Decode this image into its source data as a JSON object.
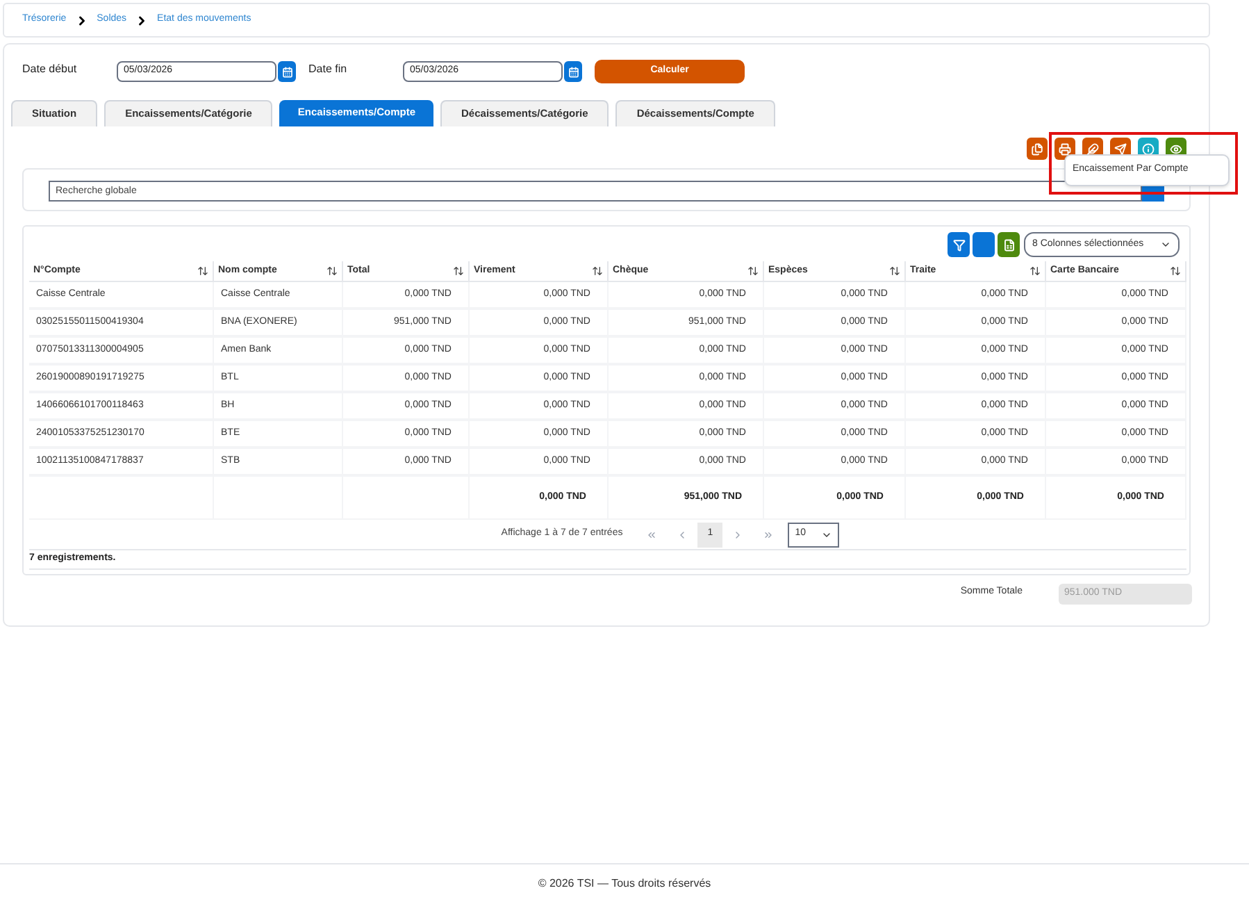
{
  "breadcrumb": [
    {
      "label": "Trésorerie"
    },
    {
      "label": "Soldes"
    },
    {
      "label": "Etat des mouvements"
    }
  ],
  "filters": {
    "date_start": {
      "label": "Date début",
      "value": "05/03/2026"
    },
    "date_end": {
      "label": "Date fin",
      "value": "05/03/2026"
    },
    "submit": "Calculer"
  },
  "tabs": [
    {
      "label": "Situation",
      "selected": false
    },
    {
      "label": "Encaissements/Catégorie",
      "selected": false
    },
    {
      "label": "Encaissements/Compte",
      "selected": true
    },
    {
      "label": "Décaissements/Catégorie",
      "selected": false
    },
    {
      "label": "Décaissements/Compte",
      "selected": false
    }
  ],
  "action_buttons": [
    {
      "kind": "files",
      "color": "#d35400"
    },
    {
      "kind": "print",
      "color": "#d35400"
    },
    {
      "kind": "feather",
      "color": "#d35400"
    },
    {
      "kind": "send",
      "color": "#d35400"
    },
    {
      "kind": "info",
      "color": "#17abc4"
    },
    {
      "kind": "eye",
      "color": "#4e8a0e"
    }
  ],
  "tooltip": "Encaissement Par Compte",
  "search": {
    "placeholder": "Recherche globale"
  },
  "table_toolbar": {
    "buttons": [
      {
        "kind": "filter"
      },
      {
        "kind": "blank"
      },
      {
        "kind": "excel"
      }
    ],
    "columns_select": "8 Colonnes sélectionnées"
  },
  "table": {
    "columns": [
      "N°Compte",
      "Nom compte",
      "Total",
      "Virement",
      "Chèque",
      "Espèces",
      "Traite",
      "Carte Bancaire"
    ],
    "rows": [
      [
        "Caisse Centrale",
        "Caisse Centrale",
        "0,000 TND",
        "0,000 TND",
        "0,000 TND",
        "0,000 TND",
        "0,000 TND",
        "0,000 TND"
      ],
      [
        "03025155011500419304",
        "BNA (EXONERE)",
        "951,000 TND",
        "0,000 TND",
        "951,000 TND",
        "0,000 TND",
        "0,000 TND",
        "0,000 TND"
      ],
      [
        "07075013311300004905",
        "Amen Bank",
        "0,000 TND",
        "0,000 TND",
        "0,000 TND",
        "0,000 TND",
        "0,000 TND",
        "0,000 TND"
      ],
      [
        "26019000890191719275",
        "BTL",
        "0,000 TND",
        "0,000 TND",
        "0,000 TND",
        "0,000 TND",
        "0,000 TND",
        "0,000 TND"
      ],
      [
        "14066066101700118463",
        "BH",
        "0,000 TND",
        "0,000 TND",
        "0,000 TND",
        "0,000 TND",
        "0,000 TND",
        "0,000 TND"
      ],
      [
        "24001053375251230170",
        "BTE",
        "0,000 TND",
        "0,000 TND",
        "0,000 TND",
        "0,000 TND",
        "0,000 TND",
        "0,000 TND"
      ],
      [
        "10021135100847178837",
        "STB",
        "0,000 TND",
        "0,000 TND",
        "0,000 TND",
        "0,000 TND",
        "0,000 TND",
        "0,000 TND"
      ]
    ],
    "totals": [
      "0,000 TND",
      "951,000 TND",
      "0,000 TND",
      "0,000 TND",
      "0,000 TND"
    ]
  },
  "pagination": {
    "info": "Affichage 1 à 7 de 7 entrées",
    "pages": [
      {
        "label": "1",
        "selected": true
      }
    ],
    "page_size": "10"
  },
  "record_count": "7 enregistrements.",
  "summary": {
    "label": "Somme Totale",
    "value": "951.000 TND",
    "disabled": true
  },
  "footer": "© 2026 TSI — Tous droits réservés"
}
